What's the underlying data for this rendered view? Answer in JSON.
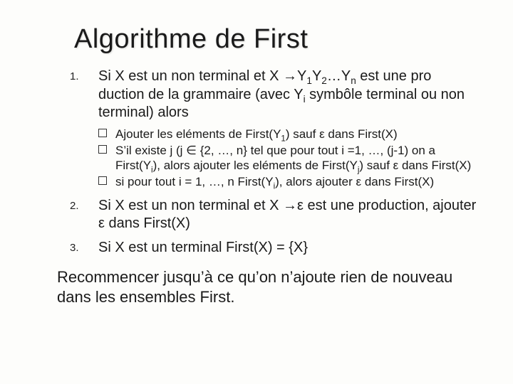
{
  "title": "Algorithme de First",
  "items": [
    {
      "text_html": "Si X est un non terminal et X <span class='arrow'>&#8594;</span>Y<sub>1</sub>Y<sub>2</sub>&hellip;Y<sub>n</sub> est une pro duction de la grammaire (avec Y<sub>i</sub> symb&ocirc;le terminal ou non terminal) alors",
      "sub": [
        "Ajouter les el&eacute;ments de First(Y<sub>1</sub>) sauf &epsilon; dans First(X)",
        "S&rsquo;il existe j (j &isin; {2, &hellip;, n} tel que pour tout i =1, &hellip;, (j-1) on a First(Y<sub>i</sub>), alors ajouter les el&eacute;ments de First(Y<sub>j</sub>) sauf &epsilon; dans First(X)",
        "si pour tout i = 1, &hellip;, n First(Y<sub>i</sub>), alors ajouter &epsilon; dans First(X)"
      ]
    },
    {
      "text_html": "Si X est un non terminal et X <span class='arrow'>&#8594;</span>&epsilon; est une production, ajouter &epsilon; dans First(X)",
      "sub": []
    },
    {
      "text_html": "Si X est un terminal First(X) = {X}",
      "sub": []
    }
  ],
  "closing": "Recommencer jusqu&rsquo;&agrave; ce qu&rsquo;on n&rsquo;ajoute rien de nouveau dans les ensembles First."
}
